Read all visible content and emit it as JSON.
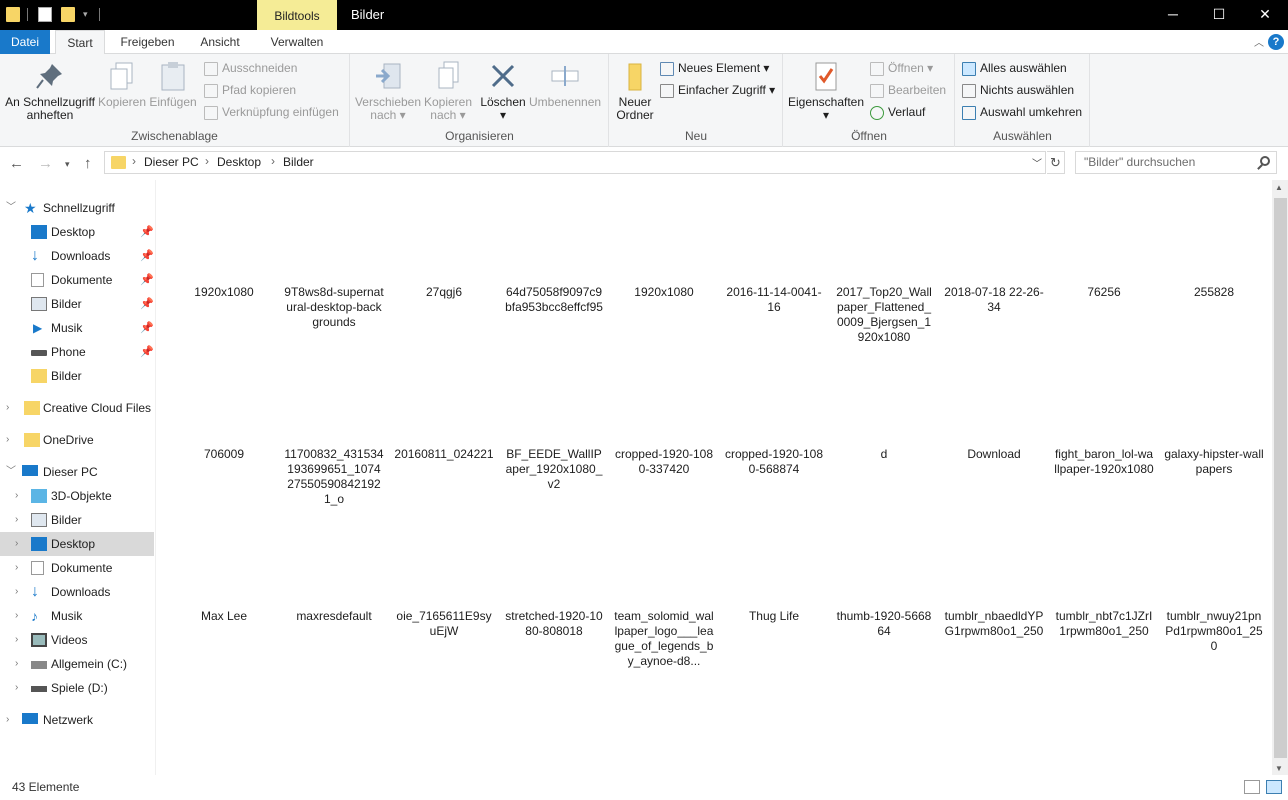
{
  "window": {
    "title": "Bilder",
    "context_tab": "Bildtools",
    "minimize_glyph": "─",
    "maximize_glyph": "☐",
    "close_glyph": "✕"
  },
  "tabs": {
    "datei": "Datei",
    "start": "Start",
    "freigeben": "Freigeben",
    "ansicht": "Ansicht",
    "verwalten": "Verwalten"
  },
  "ribbon": {
    "clipboard": {
      "label": "Zwischenablage",
      "pin_line1": "An Schnellzugriff",
      "pin_line2": "anheften",
      "copy": "Kopieren",
      "paste": "Einfügen",
      "cut": "Ausschneiden",
      "copy_path": "Pfad kopieren",
      "paste_shortcut": "Verknüpfung einfügen"
    },
    "organize": {
      "label": "Organisieren",
      "move_line1": "Verschieben",
      "move_line2": "nach",
      "copyto_line1": "Kopieren",
      "copyto_line2": "nach",
      "delete": "Löschen",
      "rename": "Umbenennen"
    },
    "new": {
      "label": "Neu",
      "folder_line1": "Neuer",
      "folder_line2": "Ordner",
      "new_item": "Neues Element",
      "easy_access": "Einfacher Zugriff"
    },
    "open": {
      "label": "Öffnen",
      "properties": "Eigenschaften",
      "open": "Öffnen",
      "edit": "Bearbeiten",
      "history": "Verlauf"
    },
    "select": {
      "label": "Auswählen",
      "select_all": "Alles auswählen",
      "select_none": "Nichts auswählen",
      "invert": "Auswahl umkehren"
    }
  },
  "address": {
    "crumbs": [
      "Dieser PC",
      "Desktop",
      "Bilder"
    ],
    "search_placeholder": "\"Bilder\" durchsuchen"
  },
  "nav": {
    "quick_access": "Schnellzugriff",
    "quick_items": [
      "Desktop",
      "Downloads",
      "Dokumente",
      "Bilder",
      "Musik",
      "Phone",
      "Bilder"
    ],
    "creative_cloud": "Creative Cloud Files",
    "onedrive": "OneDrive",
    "this_pc": "Dieser PC",
    "pc_items": [
      "3D-Objekte",
      "Bilder",
      "Desktop",
      "Dokumente",
      "Downloads",
      "Musik",
      "Videos",
      "Allgemein (C:)",
      "Spiele (D:)"
    ],
    "network": "Netzwerk"
  },
  "files": {
    "row1": [
      "1920x1080",
      "9T8ws8d-supernatural-desktop-backgrounds",
      "27qgj6",
      "64d75058f9097c9bfa953bcc8effcf95",
      "1920x1080",
      "2016-11-14-0041-16",
      "2017_Top20_Wallpaper_Flattened_0009_Bjergsen_1920x1080",
      "2018-07-18 22-26-34",
      "76256",
      "255828"
    ],
    "row2": [
      "706009",
      "11700832_431534193699651_1074275505908421921_o",
      "20160811_024221",
      "BF_EEDE_WallIPaper_1920x1080_v2",
      "cropped-1920-1080-337420",
      "cropped-1920-1080-568874",
      "d",
      "Download",
      "fight_baron_lol-wallpaper-1920x1080",
      "galaxy-hipster-wallpapers"
    ],
    "row3": [
      "Max Lee",
      "maxresdefault",
      "oie_7165611E9syuEjW",
      "stretched-1920-1080-808018",
      "team_solomid_wallpaper_logo___league_of_legends_by_aynoe-d8...",
      "Thug Life",
      "thumb-1920-566864",
      "tumblr_nbaedldYPG1rpwm80o1_250",
      "tumblr_nbt7c1JZrI1rpwm80o1_250",
      "tumblr_nwuy21pnPd1rpwm80o1_250"
    ]
  },
  "status": {
    "count": "43 Elemente"
  }
}
